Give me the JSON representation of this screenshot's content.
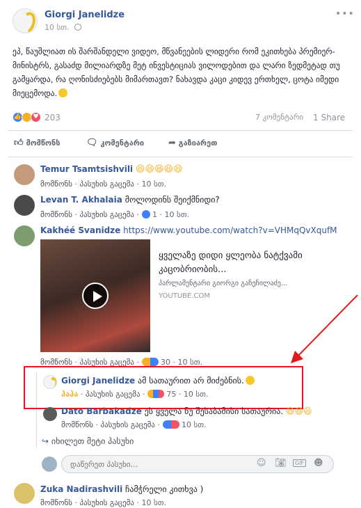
{
  "post": {
    "author": "Giorgi Janelidze",
    "time": "10 სთ.",
    "body": "ეპ, წაუშლიათ ის შარშანდელი ვიდეო, მწვანეების ლიდერი რომ ეკითხება პრემიერ-მინისტრს, გასაძდ მილიარდზე მეტ ინვესტიციას ვილოდებით და ლარი ზედმეტად თუ გამყარდა, რა ღონისძიებებს მიმართავთ? ნახავდა კაცი კიდევ ერთხელ, ცოტა იმედი მიეცემოდა.",
    "reaction_count": "203",
    "comments_count": "7 კომენტარი",
    "shares_count": "1 Share",
    "menu": "•••"
  },
  "actions": {
    "like": "მომწონს",
    "comment": "კომენტარი",
    "share": "გაზიარეთ"
  },
  "comments": [
    {
      "author": "Temur Tsamtsishvili",
      "text": "😆😆😆😆😆",
      "like": "მომწონს",
      "reply": "პასუხის გაცემა",
      "time": "10 სთ."
    },
    {
      "author": "Levan T. Akhalaia",
      "text": "მოლოდინს შეიქმნიდი?",
      "like": "მომწონს",
      "reply": "პასუხის გაცემა",
      "likes": "1",
      "time": "10 სთ."
    },
    {
      "author": "Kakhéé Svanidze",
      "text": "https://www.youtube.com/watch?v=VHMqQvXqufM",
      "like": "მომწონს",
      "reply": "პასუხის გაცემა",
      "reactions": "30",
      "time": "10 სთ.",
      "preview": {
        "title": "ყველაზე დიდი ყლეობა ნატქვამი კაცობრიობის...",
        "desc": "პარლამენტარი გიორგი გაჩეჩილაძე...",
        "site": "YOUTUBE.COM"
      }
    }
  ],
  "replies": [
    {
      "author": "Giorgi Janelidze",
      "text": "ამ სათაურით არ მიძებნის.",
      "like": "ჰაჰა",
      "reply": "პასუხის გაცემა",
      "reactions": "75",
      "time": "10 სთ."
    },
    {
      "author": "Dato Barbakadze",
      "text": "ეს ყველა ნუ შესაბამისი სათაურია.",
      "like": "მომწონს",
      "reply": "პასუხის გაცემა",
      "time": "10 სთ."
    }
  ],
  "more_replies": "იხილეთ მეტი პასუხი",
  "reply_placeholder": "დაწერეთ პასუხი...",
  "last_comment": {
    "author": "Zuka Nadirashvili",
    "text": "ჩამჭრელი კითხვა )",
    "like": "მომწონს",
    "reply": "პასუხის გაცემა",
    "time": "10 სთ."
  },
  "icons": {
    "globe": "globe-icon",
    "like": "thumbs-up-icon",
    "comment": "speech-bubble-icon",
    "share": "share-arrow-icon"
  },
  "colors": {
    "link": "#365899",
    "highlight_box": "#e2191c",
    "arrow": "#e2191c"
  }
}
